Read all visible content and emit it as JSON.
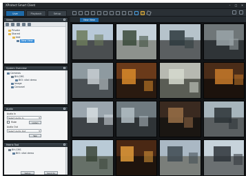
{
  "window": {
    "title": "XProtect Smart Client",
    "controls": [
      "–",
      "□",
      "×"
    ]
  },
  "tabs": [
    {
      "label": "Live",
      "active": true
    },
    {
      "label": "Playback",
      "active": false
    },
    {
      "label": "Setup",
      "active": false
    }
  ],
  "views_panel": {
    "header": "Views",
    "items": [
      {
        "label": "Private",
        "icon": "folder-icon"
      },
      {
        "label": "Shared",
        "icon": "folder-icon"
      },
      {
        "label": "test",
        "icon": "folder-icon"
      },
      {
        "label": "New View",
        "icon": "view-icon",
        "selected": true
      }
    ]
  },
  "overview_panel": {
    "header": "System Overview",
    "items": [
      {
        "label": "Cameras",
        "icon": "camera-group-icon"
      },
      {
        "label": "BH-CMS",
        "icon": "server-icon"
      },
      {
        "label": "BIO: vital demo",
        "icon": "camera-icon"
      },
      {
        "label": "Image",
        "icon": "image-icon"
      },
      {
        "label": "Carousel",
        "icon": "carousel-icon"
      }
    ]
  },
  "audio_panel": {
    "header": "Audio",
    "audio_in_label": "Audio In",
    "audio_in_value": "Select Audio In",
    "mute_label": "Mute",
    "listen_label": "Listen",
    "audio_out_label": "Audio Out",
    "audio_out_value": "Select Audio Out",
    "talk_label": "Talk"
  },
  "matrix_panel": {
    "header": "Matrix Tool",
    "items": [
      {
        "label": "BH-CMS",
        "icon": "server-icon"
      },
      {
        "label": "BIO: vital demo",
        "icon": "camera-icon"
      }
    ],
    "buttons": [
      "Setup",
      "Send to"
    ]
  },
  "view": {
    "tab_label": "New View"
  },
  "camera_tiles": [
    {
      "scene": "street-with-cars",
      "sky": "#b8c9d8",
      "ground": "#4a4e50",
      "accent": "#6b7a5a"
    },
    {
      "scene": "parking-plaza",
      "sky": "#c5d1da",
      "ground": "#8d928d",
      "accent": "#3a4a3a"
    },
    {
      "scene": "city-intersection",
      "sky": "#b6c3cb",
      "ground": "#5b5f61",
      "accent": "#2e3a3e"
    },
    {
      "scene": "overhead-parking-lot",
      "sky": "#6f7678",
      "ground": "#2f3437",
      "accent": "#9aa4a8"
    },
    {
      "scene": "storefront-entrance",
      "sky": "#8e9aa0",
      "ground": "#4b5155",
      "accent": "#c7cdd1"
    },
    {
      "scene": "casino-hall",
      "sky": "#6a3a1a",
      "ground": "#2a1a10",
      "accent": "#d88a2a"
    },
    {
      "scene": "warehouse-interior",
      "sky": "#b7b9b1",
      "ground": "#5a5d55",
      "accent": "#d6d9cf"
    },
    {
      "scene": "bar-interior",
      "sky": "#4a2c18",
      "ground": "#1c120c",
      "accent": "#c77a2a"
    },
    {
      "scene": "factory-floor",
      "sky": "#9aa5ad",
      "ground": "#3e4347",
      "accent": "#d6dde1"
    },
    {
      "scene": "office-lobby",
      "sky": "#6f7a80",
      "ground": "#2f3437",
      "accent": "#b3bec4"
    },
    {
      "scene": "restaurant-table",
      "sky": "#3a2a20",
      "ground": "#1a1612",
      "accent": "#9a7048"
    },
    {
      "scene": "road-with-traffic",
      "sky": "#a7b5bc",
      "ground": "#5a5f61",
      "accent": "#2c3236"
    },
    {
      "scene": "building-courtyard",
      "sky": "#b9cad6",
      "ground": "#667068",
      "accent": "#3a4538"
    },
    {
      "scene": "casino-floor",
      "sky": "#4a2814",
      "ground": "#1f140d",
      "accent": "#e09a3a"
    },
    {
      "scene": "building-facade",
      "sky": "#aab8c4",
      "ground": "#7a7e7a",
      "accent": "#3f4a52"
    },
    {
      "scene": "highway-aerial",
      "sky": "#c7d3db",
      "ground": "#6b7072",
      "accent": "#2d3338"
    }
  ]
}
